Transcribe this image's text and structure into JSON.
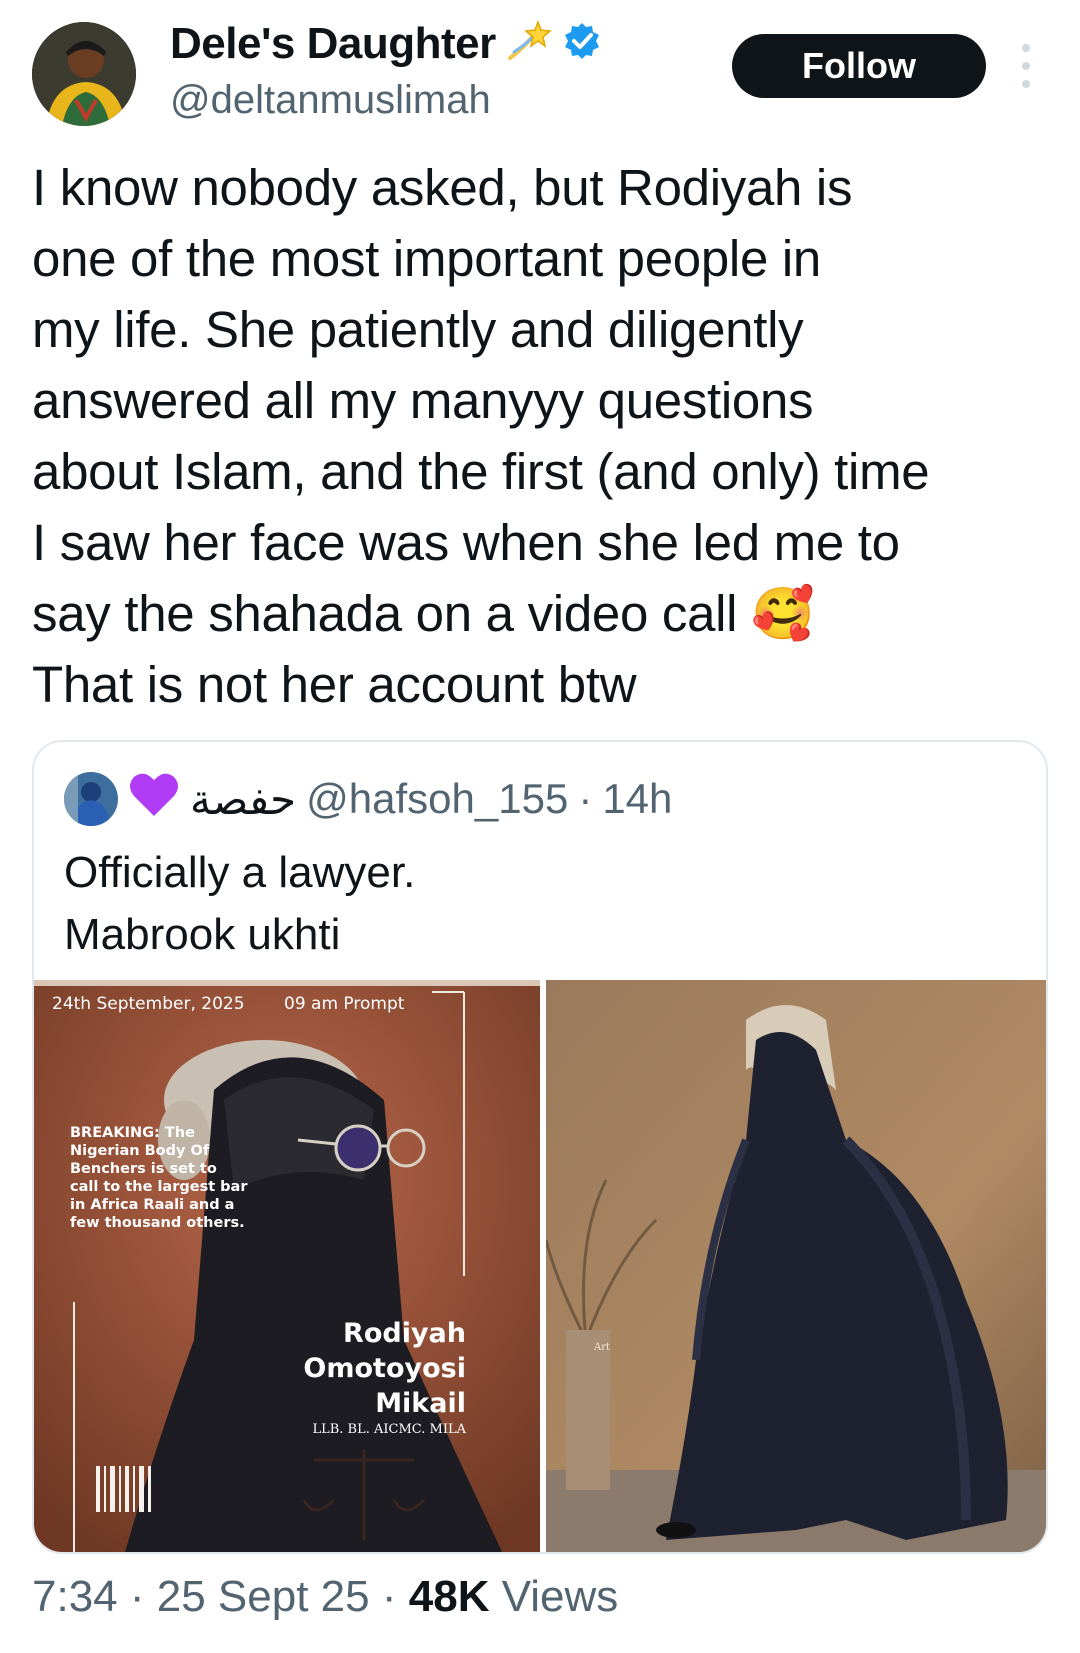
{
  "author": {
    "display_name": "Dele's Daughter",
    "handle": "@deltanmuslimah",
    "verified": true,
    "follow_label": "Follow"
  },
  "tweet": {
    "lines": [
      "I know nobody asked, but Rodiyah is",
      "one of the most important people in",
      "my life. She patiently and diligently",
      "answered all my manyyy questions",
      "about Islam, and the first (and only) time",
      "I saw her face was when she led me to",
      "say the shahada on a video call 🥰",
      "That is not her account btw"
    ]
  },
  "quoted": {
    "display_name": "حفصة",
    "handle": "@hafsoh_155",
    "time": "14h",
    "separator": "·",
    "lines": [
      "Officially a lawyer.",
      "Mabrook ukhti"
    ],
    "poster": {
      "date": "24th September, 2025",
      "time": "09 am Prompt",
      "breaking_lines": [
        "BREAKING: The",
        "Nigerian Body Of",
        "Benchers is set to",
        "call to the largest bar",
        "in Africa Raali and a",
        "few thousand others."
      ],
      "name_lines": [
        "Rodiyah",
        "Omotoyosi",
        "Mikail"
      ],
      "credentials": "LLB. BL. AICMC. MILA"
    }
  },
  "footer": {
    "time": "7:34",
    "date": "25 Sept 25",
    "views_count": "48K",
    "views_label": "Views",
    "separator": "·"
  },
  "colors": {
    "text": "#0f1419",
    "muted": "#536471",
    "verified": "#1d9bf0",
    "poster_bg": "#8a4a2f"
  }
}
